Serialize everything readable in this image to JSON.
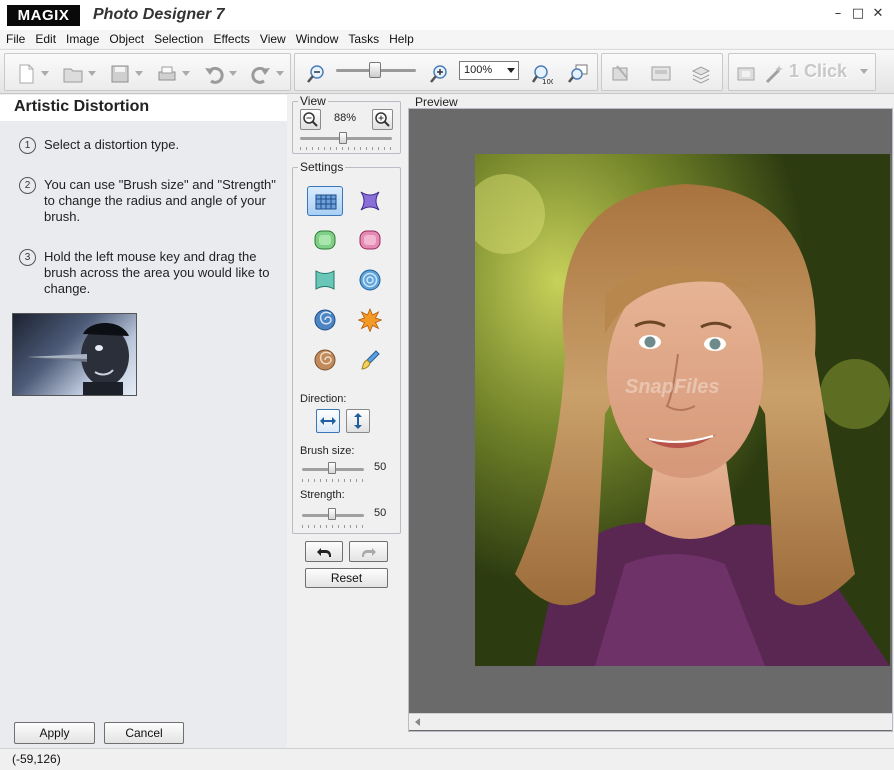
{
  "window": {
    "brand": "MAGIX",
    "title": "Photo Designer 7",
    "controls": {
      "minimize": "–",
      "maximize": "□",
      "close": "✕"
    }
  },
  "menu": [
    "File",
    "Edit",
    "Image",
    "Object",
    "Selection",
    "Effects",
    "View",
    "Window",
    "Tasks",
    "Help"
  ],
  "toolbar": {
    "zoom_value": "100%",
    "oneclick_label": "1 Click"
  },
  "panel": {
    "title": "Artistic Distortion",
    "steps": [
      {
        "num": "1",
        "text": "Select a distortion type."
      },
      {
        "num": "2",
        "text": "You can use \"Brush size\" and \"Strength\" to change the radius and angle of your brush."
      },
      {
        "num": "3",
        "text": "Hold the left mouse key and drag the brush across the area you would like to change."
      }
    ],
    "apply_label": "Apply",
    "cancel_label": "Cancel"
  },
  "view_group": {
    "label": "View",
    "zoom_percent": "88%"
  },
  "settings_group": {
    "label": "Settings",
    "direction_label": "Direction:",
    "brush_size_label": "Brush size:",
    "brush_size_value": "50",
    "strength_label": "Strength:",
    "strength_value": "50",
    "reset_label": "Reset"
  },
  "preview": {
    "label": "Preview",
    "watermark": "SnapFiles"
  },
  "status": {
    "coords": "(-59,126)"
  },
  "colors": {
    "selection_blue": "#3a76b8",
    "preview_bg": "#6a6a6a"
  }
}
